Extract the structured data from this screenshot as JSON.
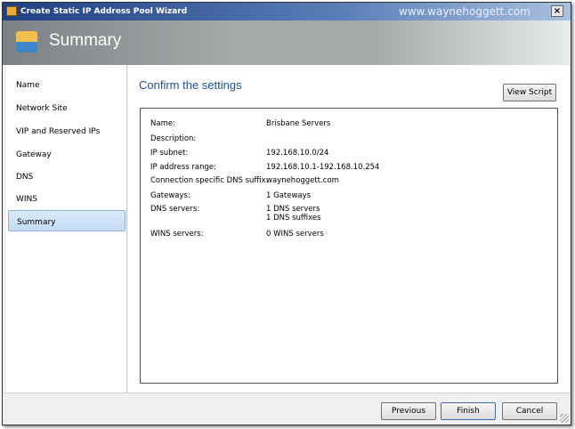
{
  "window": {
    "title": "Create Static IP Address Pool Wizard",
    "watermark": "www.waynehoggett.com",
    "close": "×"
  },
  "header": {
    "title": "Summary"
  },
  "sidebar": {
    "items": [
      {
        "label": "Name"
      },
      {
        "label": "Network Site"
      },
      {
        "label": "VIP and Reserved IPs"
      },
      {
        "label": "Gateway"
      },
      {
        "label": "DNS"
      },
      {
        "label": "WINS"
      },
      {
        "label": "Summary",
        "selected": true
      }
    ]
  },
  "main": {
    "title": "Confirm the settings",
    "view_script": "View Script",
    "rows": [
      {
        "key": "Name:",
        "value": "Brisbane Servers"
      },
      {
        "key": "Description:",
        "value": ""
      },
      {
        "key": "IP subnet:",
        "value": "192.168.10.0/24"
      },
      {
        "key": "IP address range:",
        "value": "192.168.10.1-192.168.10.254"
      },
      {
        "key": "Connection specific DNS suffix:",
        "value": "waynehoggett.com"
      },
      {
        "key": "Gateways:",
        "value": "1 Gateways"
      },
      {
        "key": "DNS servers:",
        "value": "1 DNS servers",
        "value2": "1 DNS suffixes"
      },
      {
        "key": "WINS servers:",
        "value": "0 WINS servers"
      }
    ]
  },
  "footer": {
    "previous": "Previous",
    "finish": "Finish",
    "cancel": "Cancel"
  }
}
